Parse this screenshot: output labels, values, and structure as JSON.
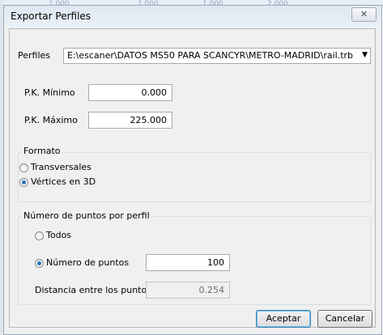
{
  "background": {
    "ghost_values": [
      "1.000",
      "1.000",
      "1.000",
      "2.000"
    ]
  },
  "window": {
    "title": "Exportar Perfiles",
    "close_glyph": "✕"
  },
  "profiles": {
    "label": "Perfiles",
    "value": "E:\\escaner\\DATOS MS50 PARA SCANCYR\\METRO-MADRID\\rail.trb",
    "arrow_icon": "▼"
  },
  "pk": {
    "min_label": "P.K. Mínimo",
    "min_value": "0.000",
    "max_label": "P.K. Máximo",
    "max_value": "225.000"
  },
  "format_group": {
    "title": "Formato",
    "options": [
      {
        "label": "Transversales",
        "checked": false
      },
      {
        "label": "Vértices en 3D",
        "checked": true
      }
    ]
  },
  "points_group": {
    "title": "Número de puntos por perfil",
    "all_label": "Todos",
    "all_checked": false,
    "count_label": "Número de puntos",
    "count_checked": true,
    "count_value": "100",
    "distance_label": "Distancia entre los puntos",
    "distance_value": "0.254"
  },
  "buttons": {
    "accept": "Aceptar",
    "cancel": "Cancelar"
  },
  "colors": {
    "accent": "#2a6fc0",
    "window_bg": "#f0f0f0"
  }
}
